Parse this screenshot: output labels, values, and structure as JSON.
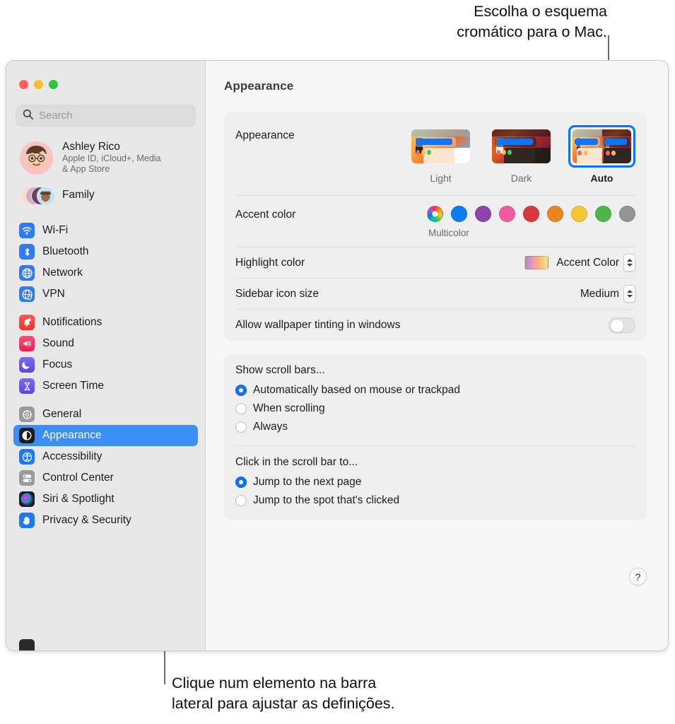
{
  "callouts": {
    "top": "Escolha o esquema\ncromático para o Mac.",
    "bottom": "Clique num elemento na barra\nlateral para ajustar as definições."
  },
  "window": {
    "title": "Appearance"
  },
  "sidebar": {
    "search_placeholder": "Search",
    "account": {
      "name": "Ashley Rico",
      "subtitle": "Apple ID, iCloud+, Media\n& App Store"
    },
    "family_label": "Family",
    "groups": [
      {
        "items": [
          {
            "label": "Wi-Fi",
            "icon": "wifi-icon",
            "color": "#2f7bf6"
          },
          {
            "label": "Bluetooth",
            "icon": "bluetooth-icon",
            "color": "#2f7bf6"
          },
          {
            "label": "Network",
            "icon": "globe-icon",
            "color": "#2f7bf6"
          },
          {
            "label": "VPN",
            "icon": "vpn-globe-icon",
            "color": "#2f7bf6"
          }
        ]
      },
      {
        "items": [
          {
            "label": "Notifications",
            "icon": "bell-icon",
            "color": "#f4483c"
          },
          {
            "label": "Sound",
            "icon": "speaker-icon",
            "color": "#f6315e"
          },
          {
            "label": "Focus",
            "icon": "moon-icon",
            "color": "#6a5af0"
          },
          {
            "label": "Screen Time",
            "icon": "hourglass-icon",
            "color": "#6a5af0"
          }
        ]
      },
      {
        "items": [
          {
            "label": "General",
            "icon": "gear-icon",
            "color": "#8e8e93",
            "selected": false
          },
          {
            "label": "Appearance",
            "icon": "appearance-icon",
            "color": "#1c1c1e",
            "selected": true
          },
          {
            "label": "Accessibility",
            "icon": "accessibility-icon",
            "color": "#1d7af3"
          },
          {
            "label": "Control Center",
            "icon": "control-center-icon",
            "color": "#8e8e93"
          },
          {
            "label": "Siri & Spotlight",
            "icon": "siri-icon",
            "color": "#3a2a4d"
          },
          {
            "label": "Privacy & Security",
            "icon": "hand-icon",
            "color": "#1d7af3"
          }
        ]
      }
    ]
  },
  "main": {
    "appearance": {
      "label": "Appearance",
      "options": [
        {
          "label": "Light",
          "selected": false
        },
        {
          "label": "Dark",
          "selected": false
        },
        {
          "label": "Auto",
          "selected": true
        }
      ]
    },
    "accent": {
      "label": "Accent color",
      "caption": "Multicolor",
      "swatches": [
        {
          "name": "multicolor",
          "color": "multi"
        },
        {
          "name": "blue",
          "color": "#0a7cf4"
        },
        {
          "name": "purple",
          "color": "#8e44a8"
        },
        {
          "name": "pink",
          "color": "#f45aa0"
        },
        {
          "name": "red",
          "color": "#d6393a"
        },
        {
          "name": "orange",
          "color": "#ea8420"
        },
        {
          "name": "yellow",
          "color": "#f6c632"
        },
        {
          "name": "green",
          "color": "#4fb44a"
        },
        {
          "name": "graphite",
          "color": "#949497"
        }
      ]
    },
    "highlight": {
      "label": "Highlight color",
      "value": "Accent Color"
    },
    "sidebar_icon_size": {
      "label": "Sidebar icon size",
      "value": "Medium"
    },
    "wallpaper_tinting": {
      "label": "Allow wallpaper tinting in windows",
      "enabled": false
    },
    "scroll_bars": {
      "title": "Show scroll bars...",
      "options": [
        {
          "label": "Automatically based on mouse or trackpad",
          "selected": true
        },
        {
          "label": "When scrolling",
          "selected": false
        },
        {
          "label": "Always",
          "selected": false
        }
      ]
    },
    "scroll_click": {
      "title": "Click in the scroll bar to...",
      "options": [
        {
          "label": "Jump to the next page",
          "selected": true
        },
        {
          "label": "Jump to the spot that's clicked",
          "selected": false
        }
      ]
    },
    "help_label": "?"
  }
}
